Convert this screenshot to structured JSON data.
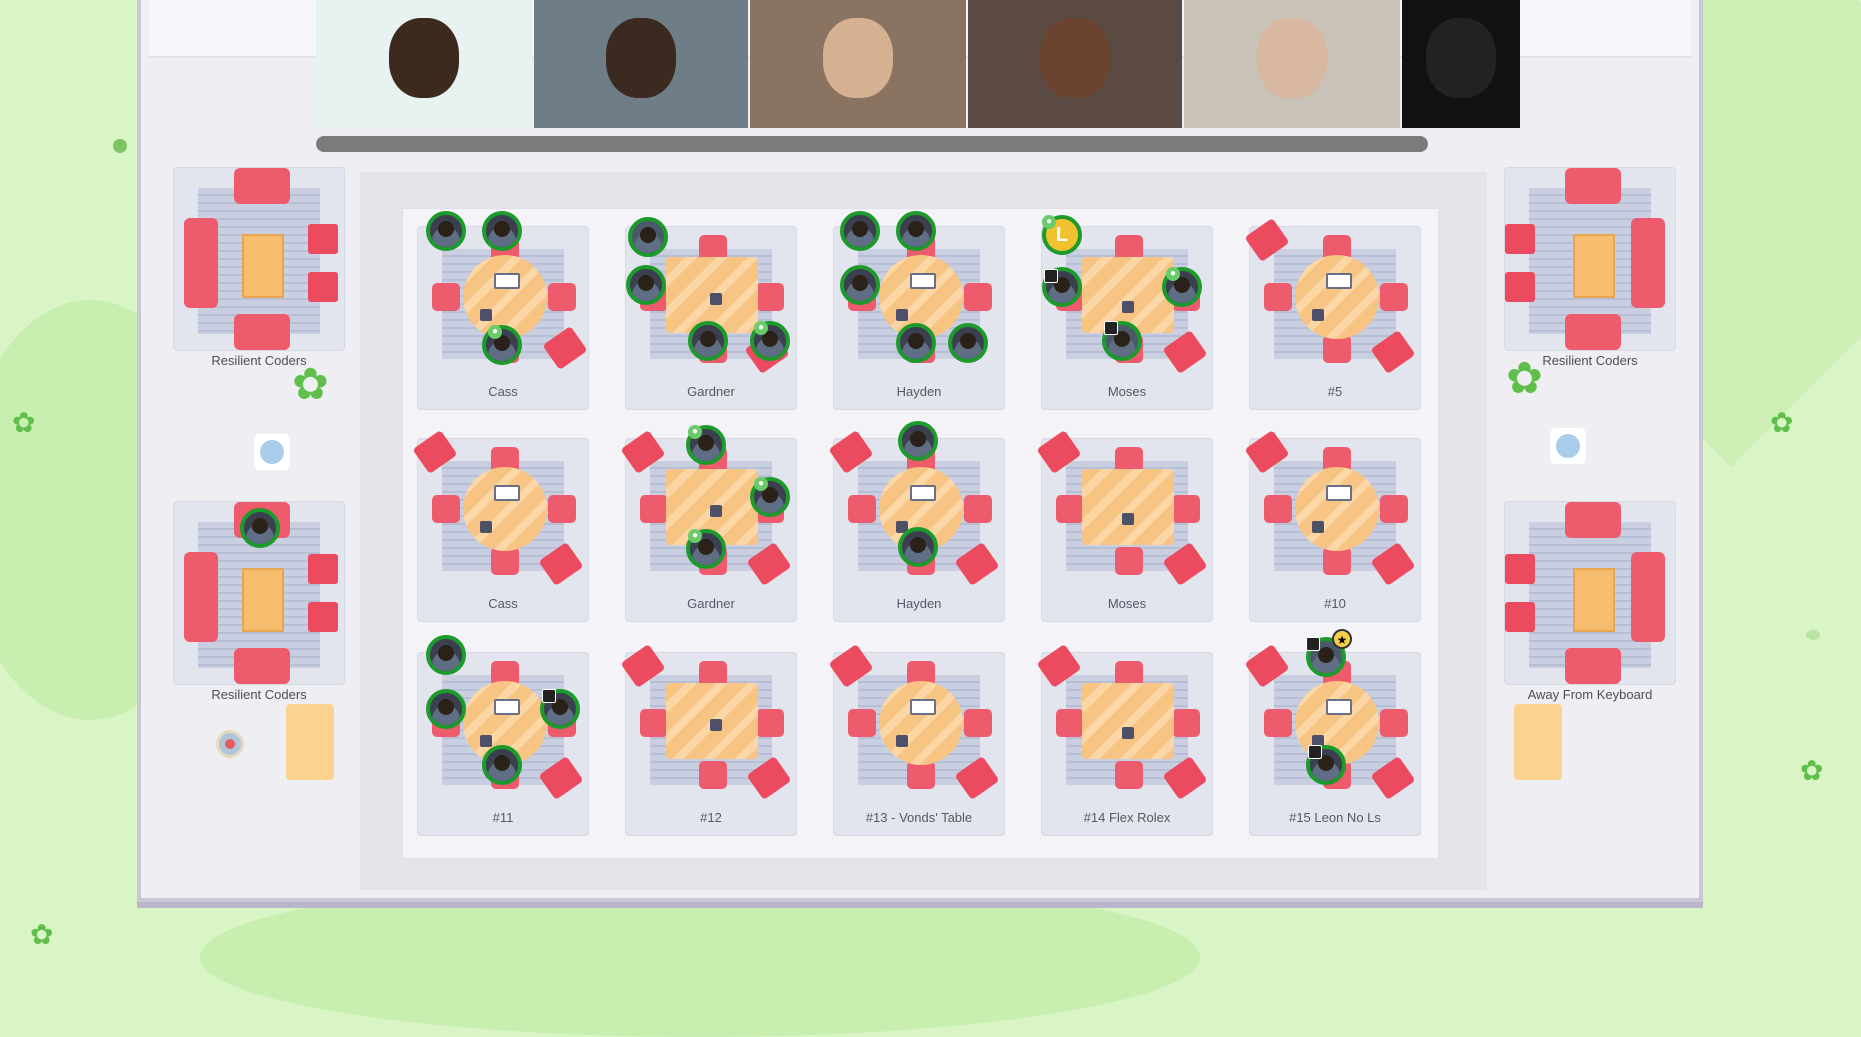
{
  "side_pods": [
    {
      "label": "Resilient Coders"
    },
    {
      "label": "Resilient Coders"
    },
    {
      "label": "Resilient Coders"
    },
    {
      "label": "Away From Keyboard"
    }
  ],
  "tables": [
    {
      "label": "Cass"
    },
    {
      "label": "Gardner"
    },
    {
      "label": "Hayden"
    },
    {
      "label": "Moses"
    },
    {
      "label": "#5"
    },
    {
      "label": "Cass"
    },
    {
      "label": "Gardner"
    },
    {
      "label": "Hayden"
    },
    {
      "label": "Moses"
    },
    {
      "label": "#10"
    },
    {
      "label": "#11"
    },
    {
      "label": "#12"
    },
    {
      "label": "#13 - Vonds' Table"
    },
    {
      "label": "#14 Flex Rolex"
    },
    {
      "label": "#15 Leon No Ls"
    }
  ],
  "avatar_initial": "L",
  "colors": {
    "background": "#d9f5c6",
    "avatar_ring": "#1d9a2c",
    "chair": "#ee5b6d",
    "table": "#f7c483"
  },
  "icons": [
    "mic-icon",
    "camera-icon",
    "star-icon",
    "leaf-icon"
  ]
}
